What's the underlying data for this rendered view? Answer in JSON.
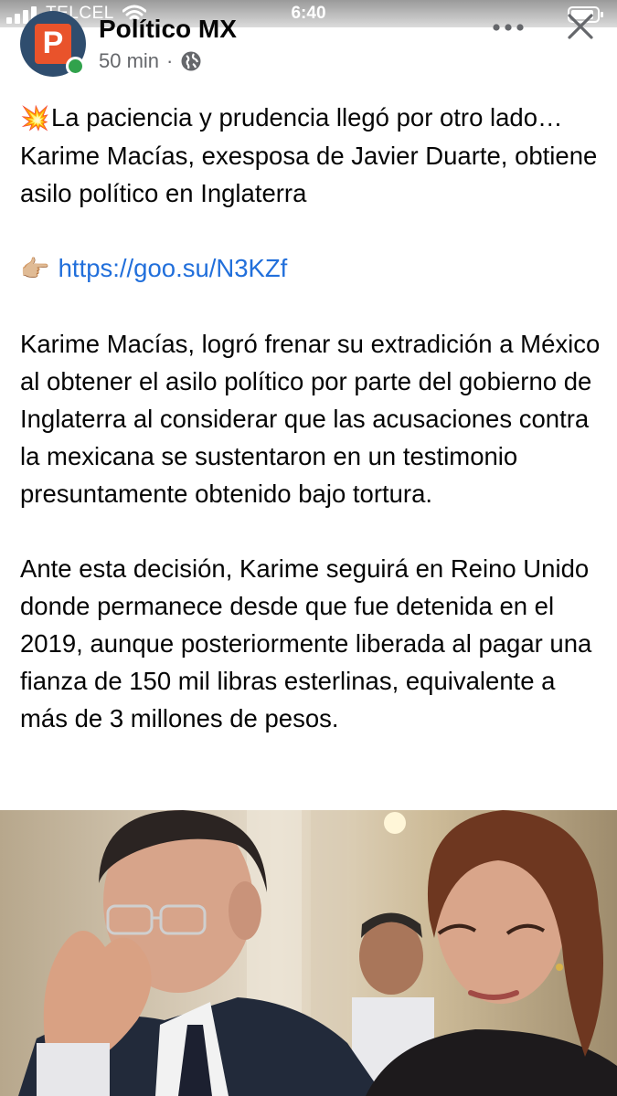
{
  "status_bar": {
    "carrier": "TELCEL",
    "time": "6:40"
  },
  "post": {
    "page_name": "Político MX",
    "avatar_letter": "P",
    "time_ago": "50 min",
    "separator": "·",
    "privacy_icon": "globe-icon",
    "headline_emoji": "💥",
    "headline": "La paciencia y prudencia llegó por otro lado… Karime Macías, exesposa de Javier Duarte, obtiene asilo político en Inglaterra",
    "link_emoji": "👉🏼",
    "link": "https://goo.su/N3KZf",
    "paragraph_1": "Karime Macías, logró frenar su extradición a México al obtener el asilo político por parte del gobierno de Inglaterra al considerar que las acusaciones contra la mexicana se sustentaron en un testimonio presuntamente obtenido bajo tortura.",
    "paragraph_2": "Ante esta decisión, Karime seguirá en Reino Unido donde permanece desde que fue detenida en el 2019, aunque posteriormente liberada al pagar una fianza de 150 mil libras esterlinas, equivalente a más de 3 millones de pesos."
  },
  "icons": {
    "more": "more-horizontal-icon",
    "close": "close-icon",
    "signal": "signal-icon",
    "wifi": "wifi-icon",
    "battery": "battery-icon"
  },
  "colors": {
    "link": "#216fdb",
    "secondary_text": "#65676b",
    "online": "#31a24c",
    "avatar_bg": "#2f4d6e",
    "avatar_accent": "#e9532b"
  }
}
